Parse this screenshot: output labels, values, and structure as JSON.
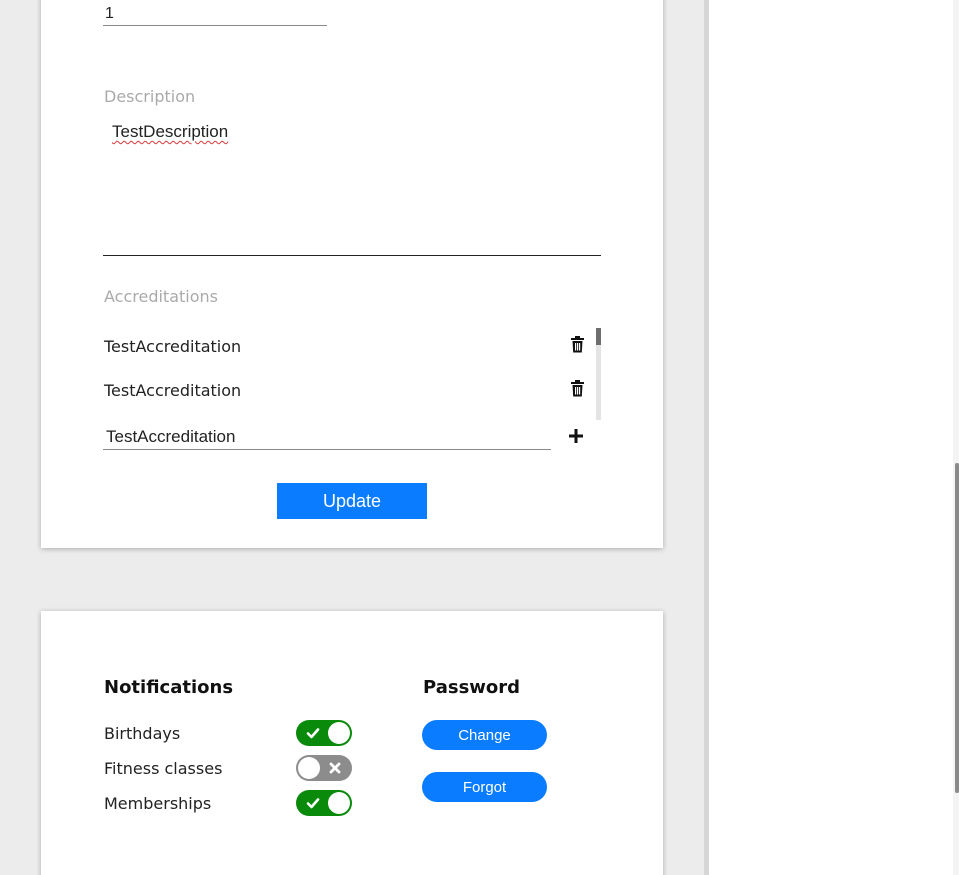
{
  "profile_form": {
    "number_value": "1",
    "description_label": "Description",
    "description_value": "TestDescription",
    "accreditations_label": "Accreditations",
    "accreditations": [
      "TestAccreditation",
      "TestAccreditation"
    ],
    "new_accreditation_value": "TestAccreditation",
    "update_label": "Update"
  },
  "settings": {
    "notifications_title": "Notifications",
    "notifications": [
      {
        "label": "Birthdays",
        "enabled": true
      },
      {
        "label": "Fitness classes",
        "enabled": false
      },
      {
        "label": "Memberships",
        "enabled": true
      }
    ],
    "password_title": "Password",
    "change_label": "Change",
    "forgot_label": "Forgot"
  },
  "colors": {
    "accent": "#0a7cff",
    "toggle_on": "#0a8a0a",
    "toggle_off": "#8c8c8c"
  },
  "icons": {
    "delete": "trash-icon",
    "add": "plus-icon",
    "toggle_on": "check-icon",
    "toggle_off": "x-icon"
  }
}
